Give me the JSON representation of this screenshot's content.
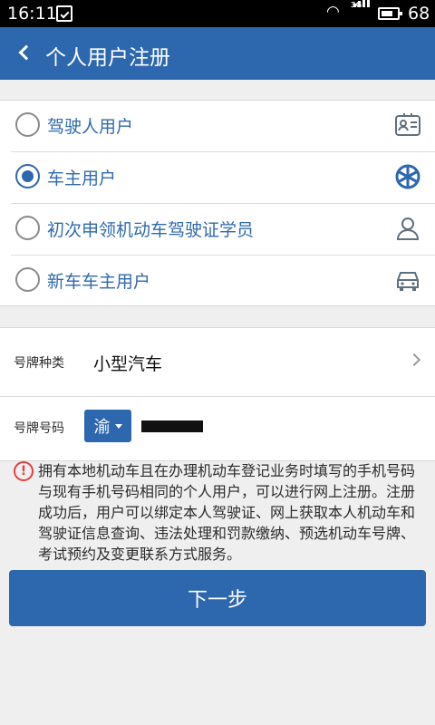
{
  "status": {
    "time": "16:11",
    "network": "3G",
    "battery": "68"
  },
  "header": {
    "title": "个人用户注册"
  },
  "user_types": [
    {
      "label": "驾驶人用户",
      "selected": false,
      "icon": "id-card-icon"
    },
    {
      "label": "车主用户",
      "selected": true,
      "icon": "steering-wheel-icon"
    },
    {
      "label": "初次申领机动车驾驶证学员",
      "selected": false,
      "icon": "person-icon"
    },
    {
      "label": "新车车主用户",
      "selected": false,
      "icon": "car-icon"
    }
  ],
  "plate": {
    "type_label": "号牌种类",
    "type_value": "小型汽车",
    "number_label": "号牌号码",
    "province": "渝",
    "number_value": ""
  },
  "notice": {
    "text": "拥有本地机动车且在办理机动车登记业务时填写的手机号码与现有手机号码相同的个人用户，可以进行网上注册。注册成功后，用户可以绑定本人驾驶证、网上获取本人机动车和驾驶证信息查询、违法处理和罚款缴纳、预选机动车号牌、考试预约及变更联系方式服务。"
  },
  "actions": {
    "next_label": "下一步"
  },
  "colors": {
    "primary": "#2d67ad",
    "warning": "#e14141"
  }
}
